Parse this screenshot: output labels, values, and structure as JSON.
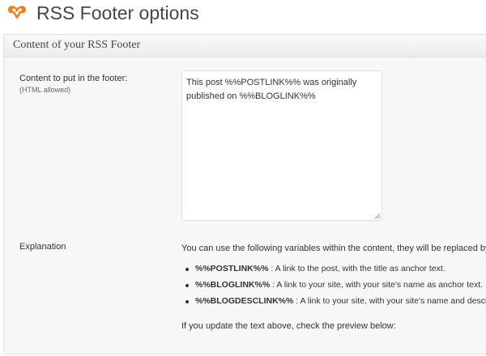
{
  "page": {
    "title": "RSS Footer options",
    "logo_icon": "orange-rss-logo-icon"
  },
  "postbox": {
    "title": "Content of your RSS Footer"
  },
  "content_field": {
    "label": "Content to put in the footer:",
    "hint": "(HTML allowed)",
    "value": "This post %%POSTLINK%% was originally published on %%BLOGLINK%%"
  },
  "explanation": {
    "label": "Explanation",
    "intro": "You can use the following variables within the content, they will be replaced by the value on the right.",
    "variables": [
      {
        "name": "%%POSTLINK%%",
        "description": " : A link to the post, with the title as anchor text."
      },
      {
        "name": "%%BLOGLINK%%",
        "description": " : A link to your site, with your site's name as anchor text."
      },
      {
        "name": "%%BLOGDESCLINK%%",
        "description": " : A link to your site, with your site's name and description as anchor text."
      }
    ],
    "update_note": "If you update the text above, check the preview below:"
  },
  "colors": {
    "logo": "#f0801d",
    "title": "#464646",
    "box_border": "#dfdfdf"
  }
}
